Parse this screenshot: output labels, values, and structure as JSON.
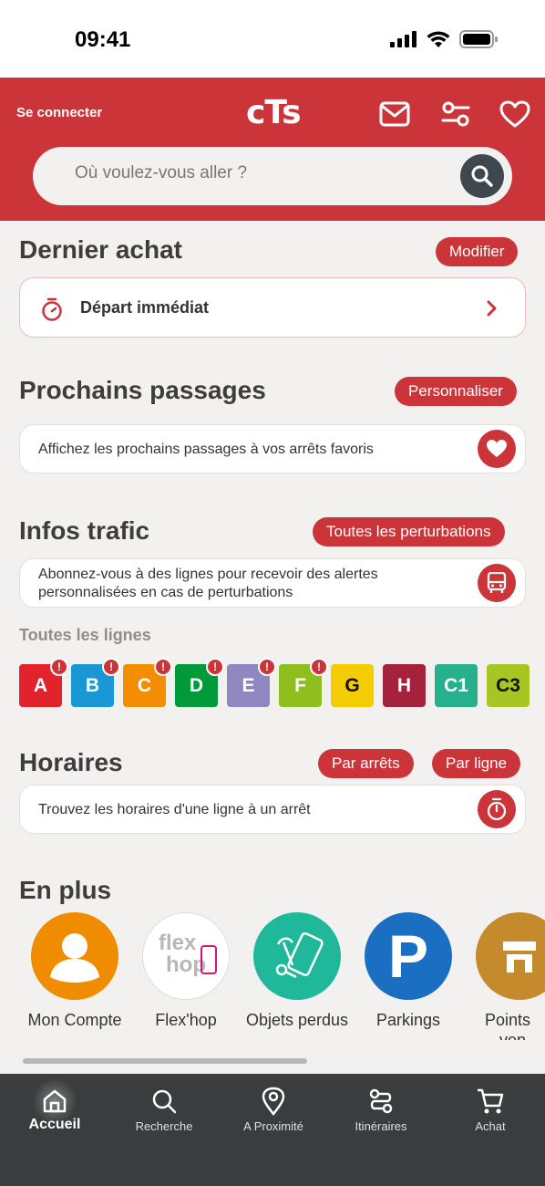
{
  "status_bar": {
    "time": "09:41"
  },
  "header": {
    "login": "Se connecter",
    "logo": "cTs",
    "search_placeholder": "Où voulez-vous aller ?"
  },
  "dernier_achat": {
    "title": "Dernier achat",
    "action": "Modifier",
    "item": "Départ immédiat"
  },
  "prochains_passages": {
    "title": "Prochains passages",
    "action": "Personnaliser",
    "text": "Affichez les prochains passages à vos arrêts favoris"
  },
  "infos_trafic": {
    "title": "Infos trafic",
    "action": "Toutes les perturbations",
    "text_line1": "Abonnez-vous à des lignes pour recevoir des alertes",
    "text_line2": "personnalisées en cas de perturbations",
    "lines_label": "Toutes les lignes",
    "lines": [
      {
        "code": "A",
        "color": "#e2232b",
        "alert": "!"
      },
      {
        "code": "B",
        "color": "#1a98d5",
        "alert": "!"
      },
      {
        "code": "C",
        "color": "#f28e00",
        "alert": "!"
      },
      {
        "code": "D",
        "color": "#009a3b",
        "alert": "!"
      },
      {
        "code": "E",
        "color": "#8e87c0",
        "alert": "!"
      },
      {
        "code": "F",
        "color": "#8fbf1f",
        "alert": "!"
      },
      {
        "code": "G",
        "color": "#f5cc00",
        "alert": ""
      },
      {
        "code": "H",
        "color": "#a5223d",
        "alert": ""
      },
      {
        "code": "C1",
        "color": "#27b08c",
        "alert": ""
      },
      {
        "code": "C3",
        "color": "#a8c623",
        "alert": ""
      }
    ]
  },
  "horaires": {
    "title": "Horaires",
    "action1": "Par arrêts",
    "action2": "Par ligne",
    "text": "Trouvez les horaires d'une ligne à un arrêt"
  },
  "en_plus": {
    "title": "En plus",
    "items": [
      {
        "label": "Mon Compte",
        "color": "#f08c00"
      },
      {
        "label": "Flex'hop",
        "color": "#ffffff",
        "logo_top": "flex",
        "logo_bottom": "hop"
      },
      {
        "label": "Objets perdus",
        "color": "#1fb89b"
      },
      {
        "label": "Parkings",
        "color": "#1a6fc2",
        "glyph": "P"
      },
      {
        "label": "Points",
        "label2": "ven",
        "color": "#c58a2c"
      }
    ]
  },
  "tabbar": {
    "tabs": [
      {
        "label": "Accueil",
        "icon": "home-icon"
      },
      {
        "label": "Recherche",
        "icon": "search-icon"
      },
      {
        "label": "A Proximité",
        "icon": "location-pin-icon"
      },
      {
        "label": "Itinéraires",
        "icon": "route-icon"
      },
      {
        "label": "Achat",
        "icon": "cart-icon"
      }
    ]
  },
  "colors": {
    "brand_red": "#cb3439",
    "tabbar": "#3a3c3d",
    "background": "#f2f1f0"
  }
}
